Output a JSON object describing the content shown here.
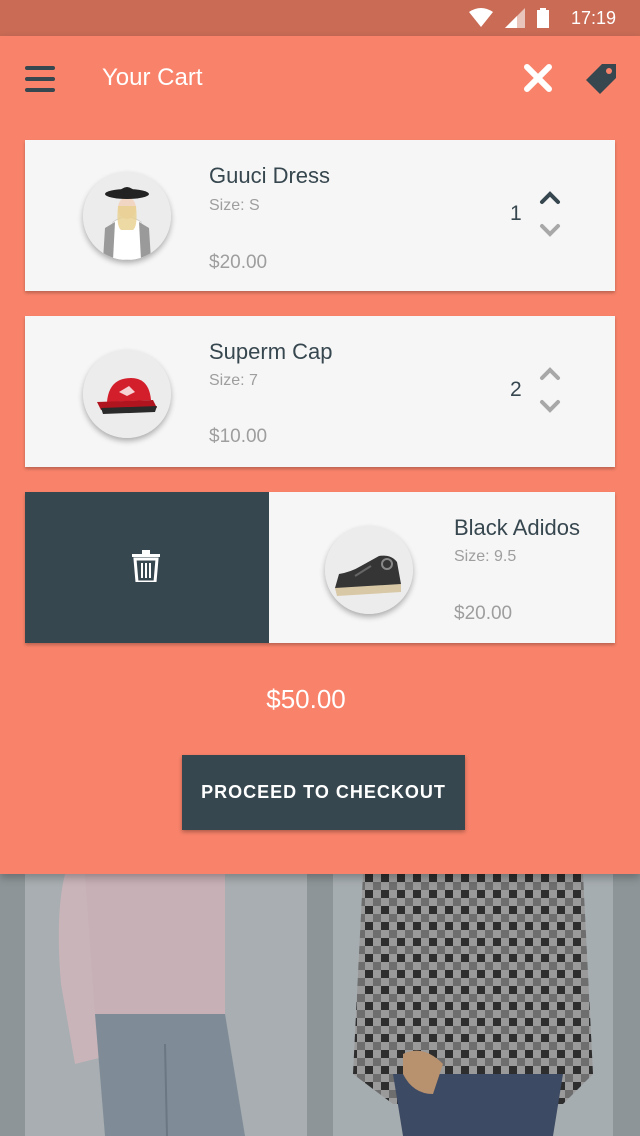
{
  "status": {
    "time": "17:19"
  },
  "header": {
    "title": "Your Cart"
  },
  "cart": {
    "items": [
      {
        "name": "Guuci Dress",
        "size_label": "Size:",
        "size": "S",
        "price": "$20.00",
        "quantity": "1"
      },
      {
        "name": "Superm Cap",
        "size_label": "Size:",
        "size": "7",
        "price": "$10.00",
        "quantity": "2"
      },
      {
        "name": "Black Adidos",
        "size_label": "Size:",
        "size": "9.5",
        "price": "$20.00"
      }
    ],
    "total": "$50.00",
    "checkout_label": "PROCEED TO CHECKOUT"
  },
  "colors": {
    "accent": "#f9836a",
    "dark": "#37474f",
    "statusbar": "#c96b55"
  },
  "icons": [
    "menu-icon",
    "close-icon",
    "tag-icon",
    "chevron-up-icon",
    "chevron-down-icon",
    "trash-icon",
    "wifi-icon",
    "signal-icon",
    "battery-icon"
  ]
}
